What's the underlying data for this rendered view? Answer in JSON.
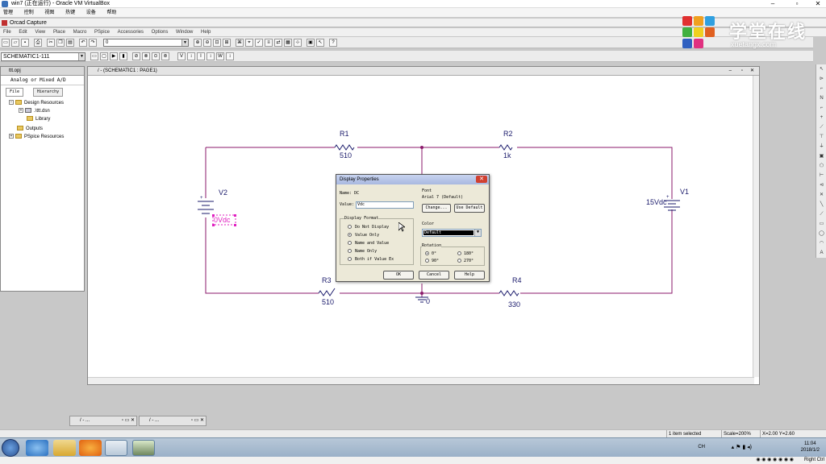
{
  "vbox": {
    "title": "win7 (正在运行) - Oracle VM VirtualBox",
    "menu": [
      "管理",
      "控制",
      "视图",
      "热键",
      "设备",
      "帮助"
    ],
    "host_key": "Right Ctrl"
  },
  "orcad": {
    "title": "Orcad Capture",
    "menu": [
      "File",
      "Edit",
      "View",
      "Place",
      "Macro",
      "PSpice",
      "Accessories",
      "Options",
      "Window",
      "Help"
    ],
    "part_combo_value": "0",
    "schematic_combo_value": "SCHEMATIC1-111"
  },
  "logo": {
    "text": "学堂在线",
    "url": "xuetangx.com"
  },
  "project": {
    "title": "ttt.opj",
    "mode": "Analog or Mixed A/D",
    "tabs": [
      "File",
      "Hierarchy"
    ],
    "tree": [
      "Design Resources",
      ".\\ttt.dsn",
      "Library",
      "Outputs",
      "PSpice Resources"
    ]
  },
  "schematic": {
    "title": "/ - (SCHEMATIC1 : PAGE1)",
    "parts": {
      "R1": {
        "ref": "R1",
        "value": "510"
      },
      "R2": {
        "ref": "R2",
        "value": "1k"
      },
      "R3": {
        "ref": "R3",
        "value": "510"
      },
      "R4": {
        "ref": "R4",
        "value": "330"
      },
      "V1": {
        "ref": "V1",
        "value": "15Vdc"
      },
      "V2": {
        "ref": "V2",
        "value": "0Vdc"
      },
      "GND": {
        "value": "0"
      }
    }
  },
  "dialog": {
    "title": "Display Properties",
    "name_label": "Name:",
    "name_value": "DC",
    "value_label": "Value:",
    "value_value": "Vdc",
    "font_label": "Font",
    "font_value": "Arial 7 (Default)",
    "change_button": "Change...",
    "use_default_button": "Use Default",
    "display_format_label": "Display Format",
    "formats": [
      "Do Not Display",
      "Value Only",
      "Name and Value",
      "Name Only",
      "Both if Value Ex"
    ],
    "selected_format": 1,
    "color_label": "Color",
    "color_value": "Default",
    "rotation_label": "Rotation",
    "rotations": [
      "0°",
      "180°",
      "90°",
      "270°"
    ],
    "ok_button": "OK",
    "cancel_button": "Cancel",
    "help_button": "Help"
  },
  "minimized": [
    "/ - ...",
    "/ - ..."
  ],
  "status": {
    "items_selected": "1 item selected",
    "scale": "Scale=200%",
    "coords": "X=2.00  Y=2.60"
  },
  "tray": {
    "time": "11:04",
    "date": "2018/1/2",
    "lang": "CH"
  },
  "colors": {
    "wire": "#8b1a6b",
    "part": "#1a1a6b",
    "selected": "#e020c0",
    "accent": "#3a70b8"
  }
}
